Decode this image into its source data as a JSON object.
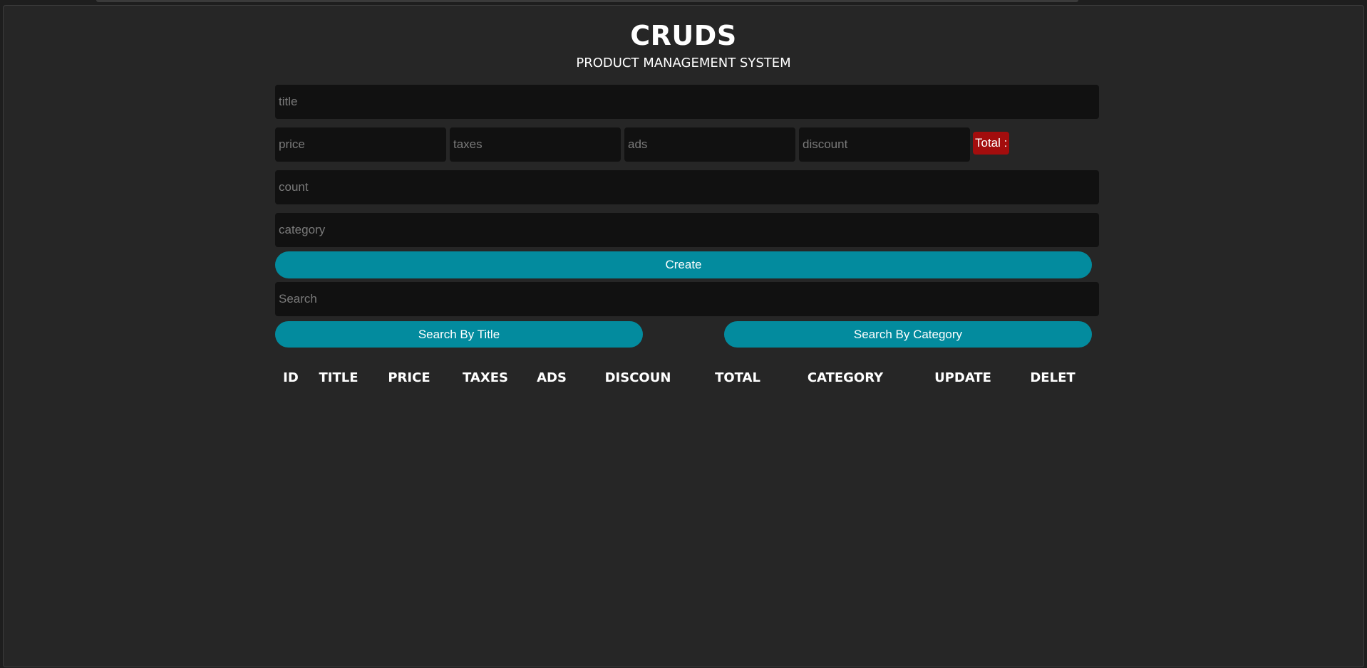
{
  "header": {
    "title": "CRUDS",
    "subtitle": "PRODUCT MANAGEMENT SYSTEM"
  },
  "form": {
    "title_placeholder": "title",
    "price_placeholder": "price",
    "taxes_placeholder": "taxes",
    "ads_placeholder": "ads",
    "discount_placeholder": "discount",
    "total_label": "Total :",
    "count_placeholder": "count",
    "category_placeholder": "category",
    "create_label": "Create"
  },
  "search": {
    "placeholder": "Search",
    "by_title_label": "Search By Title",
    "by_category_label": "Search By Category"
  },
  "table": {
    "columns": [
      "ID",
      "TITLE",
      "PRICE",
      "TAXES",
      "ADS",
      "DISCOUN",
      "TOTAL",
      "CATEGORY",
      "UPDATE",
      "DELET"
    ]
  },
  "colors": {
    "background": "#262626",
    "input_background": "#111111",
    "accent": "#038b9e",
    "total_badge": "#a30d0d"
  }
}
